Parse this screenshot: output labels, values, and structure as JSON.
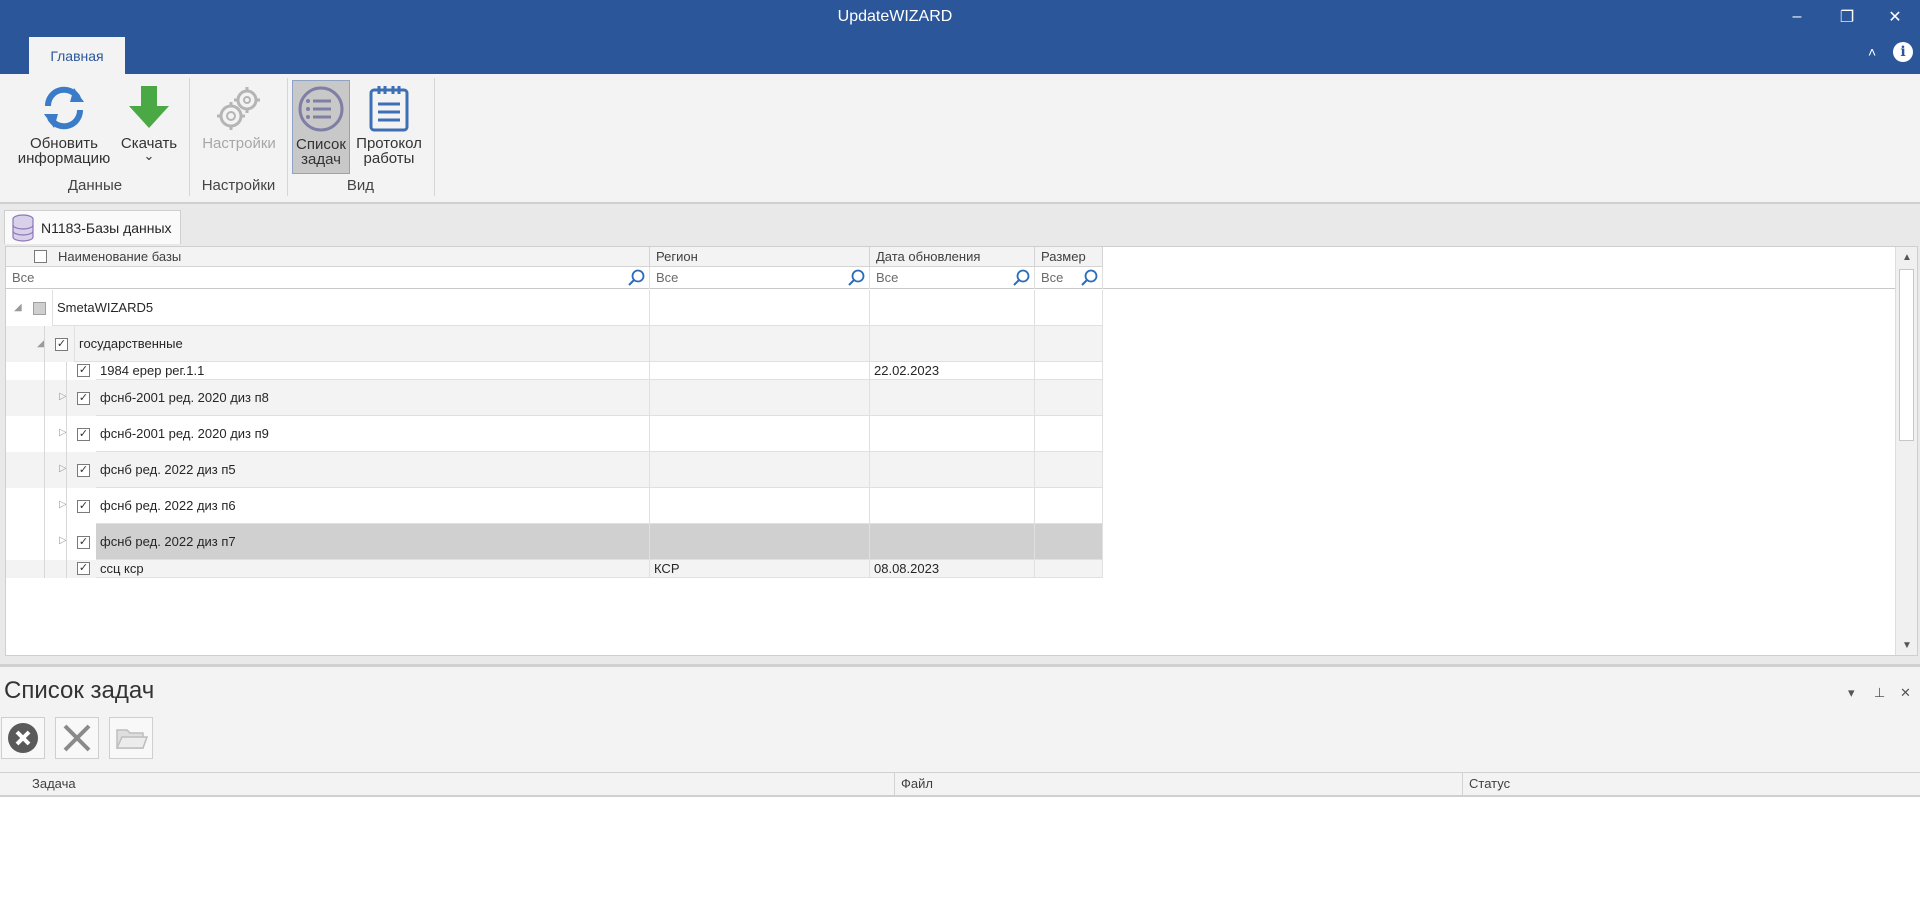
{
  "window": {
    "title": "UpdateWIZARD",
    "minimize_glyph": "–",
    "restore_glyph": "❐",
    "close_glyph": "✕"
  },
  "ribbon": {
    "tab_label": "Главная",
    "collapse_glyph": "˄",
    "info_glyph": "i",
    "buttons": {
      "refresh": {
        "line1": "Обновить",
        "line2": "информацию"
      },
      "download": {
        "label": "Скачать",
        "arrow": "⌄"
      },
      "settings": {
        "label": "Настройки"
      },
      "task_list": {
        "line1": "Список",
        "line2": "задач"
      },
      "log": {
        "line1": "Протокол",
        "line2": "работы"
      }
    },
    "groups": {
      "data": "Данные",
      "settings": "Настройки",
      "view": "Вид"
    }
  },
  "document_tab": {
    "label": "N1183-Базы данных"
  },
  "grid": {
    "columns": {
      "name": "Наименование базы",
      "region": "Регион",
      "date": "Дата обновления",
      "size": "Размер"
    },
    "filter_placeholder": "Все",
    "rows": [
      {
        "name": "SmetaWIZARD5",
        "region": "",
        "date": "",
        "size": ""
      },
      {
        "name": "государственные",
        "region": "",
        "date": "",
        "size": ""
      },
      {
        "name": "1984 ерер рег.1.1",
        "region": "",
        "date": "22.02.2023",
        "size": ""
      },
      {
        "name": "фснб-2001 ред. 2020 диз п8",
        "region": "",
        "date": "",
        "size": ""
      },
      {
        "name": "фснб-2001 ред. 2020 диз п9",
        "region": "",
        "date": "",
        "size": ""
      },
      {
        "name": "фснб ред. 2022 диз п5",
        "region": "",
        "date": "",
        "size": ""
      },
      {
        "name": "фснб ред. 2022 диз п6",
        "region": "",
        "date": "",
        "size": ""
      },
      {
        "name": "фснб ред. 2022 диз п7",
        "region": "",
        "date": "",
        "size": ""
      },
      {
        "name": "ссц кср",
        "region": "КСР",
        "date": "08.08.2023",
        "size": ""
      }
    ]
  },
  "task_panel": {
    "title": "Список задач",
    "columns": {
      "task": "Задача",
      "file": "Файл",
      "status": "Статус"
    },
    "controls": {
      "dropdown": "▾",
      "pin": "⊥",
      "close": "✕"
    }
  }
}
